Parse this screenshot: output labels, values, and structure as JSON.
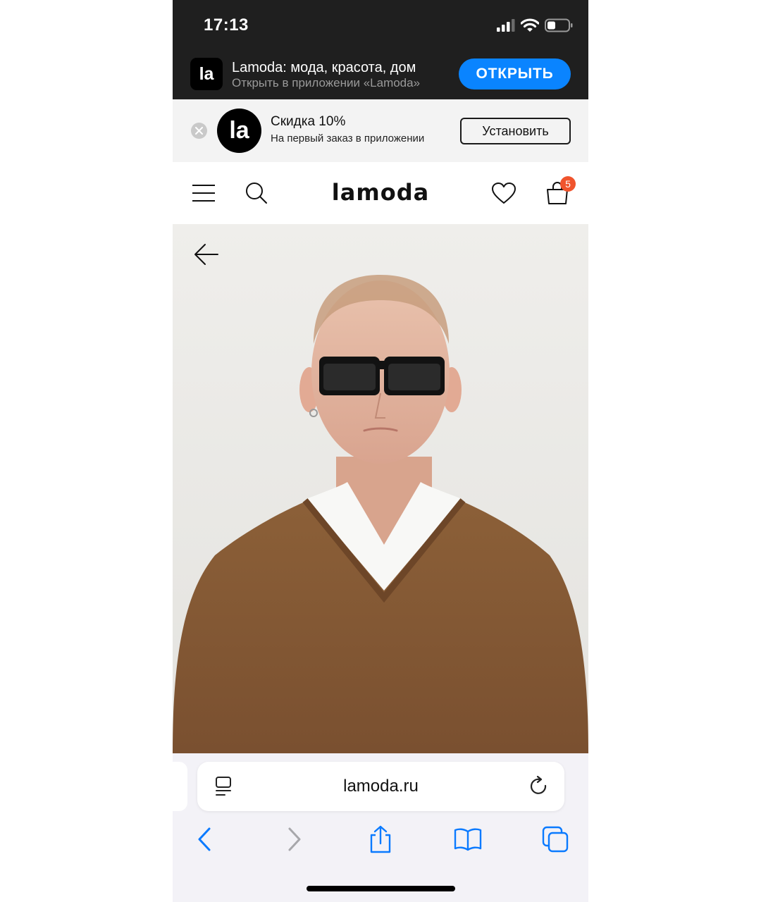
{
  "status_bar": {
    "time": "17:13"
  },
  "app_banner": {
    "icon_text": "la",
    "title": "Lamoda: мода, красота, дом",
    "subtitle": "Открыть в приложении «Lamoda»",
    "open_label": "ОТКРЫТЬ",
    "accent_color": "#0a84ff"
  },
  "promo": {
    "logo_text": "la",
    "title": "Скидка 10%",
    "subtitle": "На первый заказ в приложении",
    "install_label": "Установить"
  },
  "header": {
    "logo": "lamoda",
    "cart_count": "5",
    "badge_color": "#f0542d",
    "icons": [
      "menu-icon",
      "search-icon",
      "heart-icon",
      "cart-icon"
    ]
  },
  "product": {
    "image_subject": "model in black sunglasses and brown v-neck sweater over white t-shirt",
    "back_icon": "arrow-left-icon"
  },
  "browser": {
    "url": "lamoda.ru",
    "toolbar_icons": [
      "back-icon",
      "forward-icon",
      "share-icon",
      "bookmarks-icon",
      "tabs-icon"
    ],
    "accent_color": "#0a7aff"
  }
}
